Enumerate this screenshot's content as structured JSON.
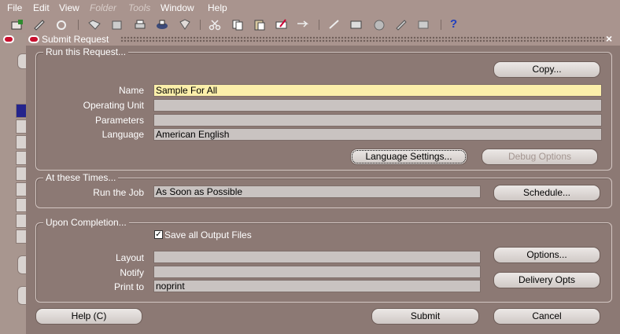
{
  "menu": {
    "items": [
      {
        "label": "File",
        "enabled": true
      },
      {
        "label": "Edit",
        "enabled": true
      },
      {
        "label": "View",
        "enabled": true
      },
      {
        "label": "Folder",
        "enabled": false
      },
      {
        "label": "Tools",
        "enabled": false
      },
      {
        "label": "Window",
        "enabled": true
      },
      {
        "label": "Help",
        "enabled": true
      }
    ]
  },
  "toolbar": {
    "icons": [
      "new-record-icon",
      "clear-icon",
      "navigate-icon",
      "open-icon",
      "save-icon",
      "print-icon",
      "print-preview-icon",
      "close-form-icon",
      "cut-icon",
      "copy-icon",
      "paste-icon",
      "edit-field-icon",
      "zoom-icon",
      "translations-icon",
      "attachments-icon",
      "folder-tools-icon",
      "globe-icon",
      "help-tool-icon",
      "summary-icon"
    ],
    "help_glyph": "?"
  },
  "dialog": {
    "title": "Submit Request",
    "close_glyph": "×",
    "run_request": {
      "group_title": "Run this Request...",
      "copy_button": "Copy...",
      "name_label": "Name",
      "name_value": "Sample For All",
      "operating_unit_label": "Operating Unit",
      "operating_unit_value": "",
      "parameters_label": "Parameters",
      "parameters_value": "",
      "language_label": "Language",
      "language_value": "American English",
      "language_settings_button": "Language Settings...",
      "debug_options_button": "Debug Options"
    },
    "times": {
      "group_title": "At these Times...",
      "run_job_label": "Run the Job",
      "run_job_value": "As Soon as Possible",
      "schedule_button": "Schedule..."
    },
    "completion": {
      "group_title": "Upon Completion...",
      "save_output_label": "Save all Output Files",
      "save_output_checked": true,
      "layout_label": "Layout",
      "layout_value": "",
      "notify_label": "Notify",
      "notify_value": "",
      "print_to_label": "Print to",
      "print_to_value": "noprint",
      "options_button": "Options...",
      "delivery_opts_button": "Delivery Opts"
    },
    "footer": {
      "help_button": "Help (C)",
      "submit_button": "Submit",
      "cancel_button": "Cancel"
    }
  },
  "colors": {
    "dialog_bg": "#8c7974",
    "active_field": "#fcefaa",
    "field_bg": "#c9c3c1"
  }
}
